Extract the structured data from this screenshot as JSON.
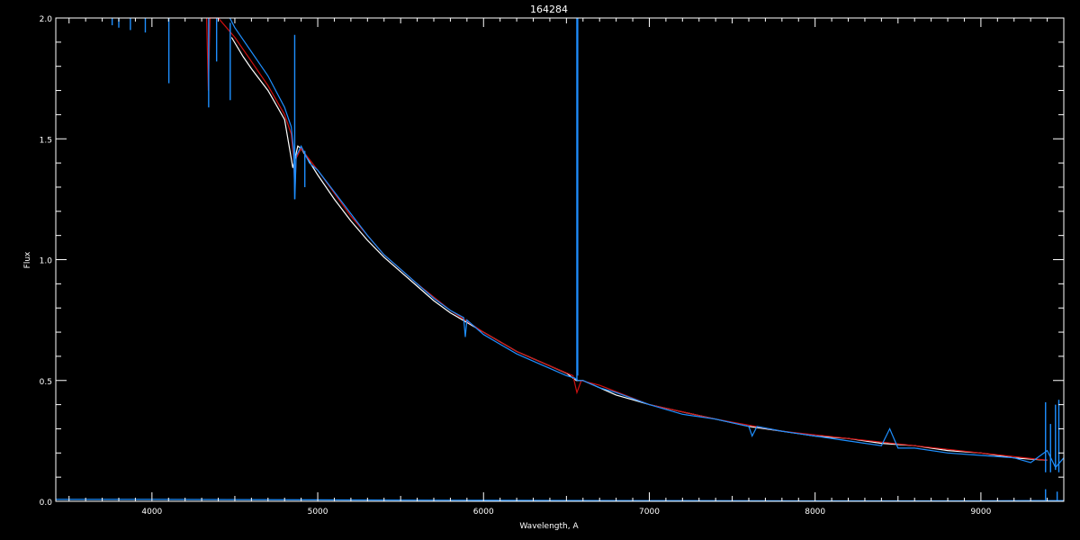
{
  "chart_data": {
    "type": "line",
    "title": "164284",
    "xlabel": "Wavelength, A",
    "ylabel": "Flux",
    "xlim": [
      3420,
      9500
    ],
    "ylim": [
      0.0,
      2.0
    ],
    "xticks": [
      4000,
      5000,
      6000,
      7000,
      8000,
      9000
    ],
    "yticks": [
      0.0,
      0.5,
      1.0,
      1.5,
      2.0
    ],
    "ytick_labels": [
      "0.0",
      "0.5",
      "1.0",
      "1.5",
      "2.0"
    ],
    "grid": false,
    "colors": {
      "background": "#000000",
      "axes": "#ffffff",
      "observed": "#ffffff",
      "model_red": "#d01010",
      "model_blue": "#1e8fff"
    },
    "series": [
      {
        "color_key": "observed",
        "x": [
          4480,
          4550,
          4600,
          4700,
          4800,
          4850,
          4880,
          4900,
          5000,
          5100,
          5200,
          5300,
          5400,
          5500,
          5600,
          5700,
          5800,
          5900,
          6000,
          6100,
          6200,
          6300,
          6400,
          6500,
          6560,
          6600,
          6700,
          6800,
          6900,
          7000,
          7200,
          7400,
          7600,
          7800,
          8000,
          8200,
          8400,
          8600,
          8800,
          9000,
          9200,
          9400
        ],
        "y": [
          1.92,
          1.84,
          1.79,
          1.7,
          1.58,
          1.38,
          1.47,
          1.46,
          1.35,
          1.25,
          1.16,
          1.08,
          1.01,
          0.95,
          0.89,
          0.83,
          0.78,
          0.74,
          0.7,
          0.66,
          0.62,
          0.59,
          0.56,
          0.53,
          0.5,
          0.5,
          0.47,
          0.44,
          0.42,
          0.4,
          0.37,
          0.34,
          0.31,
          0.29,
          0.27,
          0.26,
          0.24,
          0.23,
          0.21,
          0.2,
          0.18,
          0.17
        ]
      },
      {
        "color_key": "model_red",
        "x": [
          4330,
          4340,
          4350,
          4360,
          4400,
          4450,
          4500,
          4600,
          4700,
          4800,
          4840,
          4855,
          4862,
          4870,
          4900,
          5000,
          5200,
          5400,
          5600,
          5800,
          6000,
          6200,
          6400,
          6540,
          6563,
          6590,
          6700,
          7000,
          7400,
          7800,
          8200,
          8600,
          9000,
          9400
        ],
        "y": [
          2.0,
          1.7,
          2.0,
          2.0,
          2.0,
          1.96,
          1.92,
          1.82,
          1.72,
          1.6,
          1.52,
          1.42,
          1.28,
          1.42,
          1.46,
          1.37,
          1.18,
          1.02,
          0.9,
          0.79,
          0.7,
          0.62,
          0.56,
          0.52,
          0.45,
          0.5,
          0.48,
          0.4,
          0.34,
          0.29,
          0.26,
          0.23,
          0.2,
          0.17
        ]
      },
      {
        "color_key": "model_blue",
        "x": [
          4470,
          4500,
          4600,
          4700,
          4800,
          4840,
          4855,
          4862,
          4870,
          4900,
          4950,
          5000,
          5100,
          5200,
          5300,
          5400,
          5500,
          5600,
          5700,
          5800,
          5880,
          5890,
          5900,
          6000,
          6100,
          6200,
          6300,
          6400,
          6500,
          6550,
          6570,
          6600,
          6700,
          6800,
          7000,
          7200,
          7400,
          7600,
          7620,
          7650,
          7800,
          8000,
          8200,
          8400,
          8450,
          8500,
          8600,
          8800,
          9000,
          9200,
          9300,
          9400,
          9450,
          9500
        ],
        "y": [
          2.0,
          1.96,
          1.86,
          1.76,
          1.63,
          1.55,
          1.45,
          1.25,
          1.43,
          1.47,
          1.4,
          1.37,
          1.28,
          1.19,
          1.1,
          1.02,
          0.96,
          0.9,
          0.84,
          0.79,
          0.76,
          0.68,
          0.75,
          0.69,
          0.65,
          0.61,
          0.58,
          0.55,
          0.52,
          0.51,
          0.5,
          0.5,
          0.47,
          0.45,
          0.4,
          0.36,
          0.34,
          0.31,
          0.27,
          0.31,
          0.29,
          0.27,
          0.25,
          0.23,
          0.3,
          0.22,
          0.22,
          0.2,
          0.19,
          0.18,
          0.16,
          0.21,
          0.14,
          0.18
        ]
      },
      {
        "color_key": "model_blue",
        "x": [
          3420,
          4000,
          5000,
          6000,
          7000,
          8000,
          9000,
          9400,
          9500
        ],
        "y": [
          0.008,
          0.008,
          0.006,
          0.004,
          0.003,
          0.002,
          0.002,
          0.003,
          0.003
        ]
      }
    ],
    "spikes": [
      {
        "color_key": "model_blue",
        "x": 3760,
        "y0": 2.0,
        "y1": 1.97
      },
      {
        "color_key": "model_blue",
        "x": 3800,
        "y0": 2.0,
        "y1": 1.96
      },
      {
        "color_key": "model_blue",
        "x": 3870,
        "y0": 2.0,
        "y1": 1.95
      },
      {
        "color_key": "model_blue",
        "x": 3960,
        "y0": 2.0,
        "y1": 1.94
      },
      {
        "color_key": "model_blue",
        "x": 4102,
        "y0": 2.0,
        "y1": 1.73
      },
      {
        "color_key": "model_blue",
        "x": 4342,
        "y0": 2.0,
        "y1": 1.63
      },
      {
        "color_key": "model_blue",
        "x": 4390,
        "y0": 2.0,
        "y1": 1.82
      },
      {
        "color_key": "model_blue",
        "x": 4472,
        "y0": 1.98,
        "y1": 1.66
      },
      {
        "color_key": "model_blue",
        "x": 4861,
        "y0": 1.93,
        "y1": 1.25
      },
      {
        "color_key": "model_blue",
        "x": 4922,
        "y0": 1.45,
        "y1": 1.3
      },
      {
        "color_key": "model_blue",
        "x": 6563,
        "y0": 2.0,
        "y1": 0.5
      },
      {
        "color_key": "model_blue",
        "x": 6568,
        "y0": 2.0,
        "y1": 0.52
      },
      {
        "color_key": "model_blue",
        "x": 9390,
        "y0": 0.41,
        "y1": 0.12
      },
      {
        "color_key": "model_blue",
        "x": 9420,
        "y0": 0.32,
        "y1": 0.12
      },
      {
        "color_key": "model_blue",
        "x": 9450,
        "y0": 0.4,
        "y1": 0.13
      },
      {
        "color_key": "model_blue",
        "x": 9470,
        "y0": 0.42,
        "y1": 0.12
      },
      {
        "color_key": "model_blue",
        "x": 9390,
        "y0": 0.05,
        "y1": 0.0
      },
      {
        "color_key": "model_blue",
        "x": 9460,
        "y0": 0.04,
        "y1": 0.0
      }
    ]
  }
}
